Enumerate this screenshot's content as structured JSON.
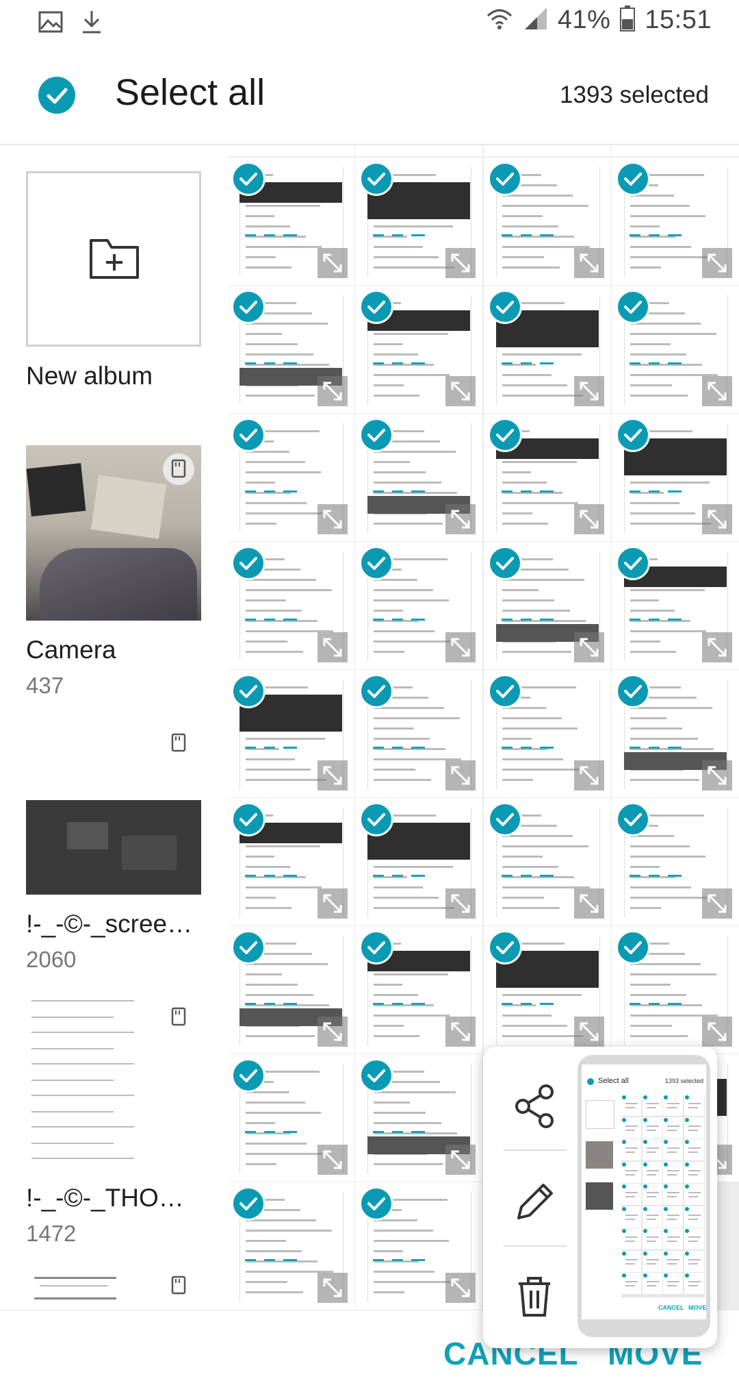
{
  "status_bar": {
    "battery": "41%",
    "time": "15:51",
    "icons": [
      "gallery-icon",
      "download-icon",
      "wifi-icon",
      "signal-icon",
      "battery-icon"
    ]
  },
  "header": {
    "title": "Select all",
    "count": "1393 selected"
  },
  "albums": [
    {
      "name": "New album",
      "count": ""
    },
    {
      "name": "Camera",
      "count": "437"
    },
    {
      "name": "!-_-©-_screen…",
      "count": "2060"
    },
    {
      "name": "!-_-©-_THOM…",
      "count": "1472"
    }
  ],
  "grid": {
    "rows": 9,
    "cols": 4,
    "selected": true
  },
  "actions": {
    "cancel": "CANCEL",
    "move": "MOVE"
  },
  "popup": {
    "items": [
      "share-icon",
      "edit-icon",
      "delete-icon"
    ],
    "preview": {
      "title": "Select all",
      "count": "1393 selected",
      "cancel": "CANCEL",
      "move": "MOVE"
    }
  },
  "colors": {
    "accent": "#0a9bb3",
    "action": "#10a2bb"
  }
}
